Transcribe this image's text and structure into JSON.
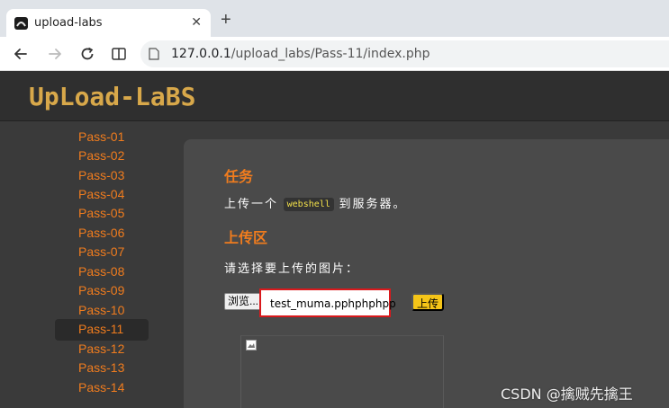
{
  "browser": {
    "tab_title": "upload-labs",
    "close_glyph": "✕",
    "new_tab_glyph": "+",
    "url_host": "127.0.0.1",
    "url_path": "/upload_labs/Pass-11/index.php"
  },
  "site": {
    "logo_text": "UpLoad-LaBS"
  },
  "sidebar": {
    "items": [
      {
        "label": "Pass-01"
      },
      {
        "label": "Pass-02"
      },
      {
        "label": "Pass-03"
      },
      {
        "label": "Pass-04"
      },
      {
        "label": "Pass-05"
      },
      {
        "label": "Pass-06"
      },
      {
        "label": "Pass-07"
      },
      {
        "label": "Pass-08"
      },
      {
        "label": "Pass-09"
      },
      {
        "label": "Pass-10"
      },
      {
        "label": "Pass-11"
      },
      {
        "label": "Pass-12"
      },
      {
        "label": "Pass-13"
      },
      {
        "label": "Pass-14"
      }
    ],
    "active": "Pass-11"
  },
  "main": {
    "task_heading": "任务",
    "task_prefix": "上传一个",
    "task_code": "webshell",
    "task_suffix": "到服务器。",
    "upload_heading": "上传区",
    "choose_label": "请选择要上传的图片：",
    "browse_label": "浏览...",
    "file_name": "test_muma.pphphphpp",
    "submit_label": "上传"
  },
  "watermark": "CSDN @擒贼先擒王",
  "colors": {
    "accent": "#f07c1e",
    "submit": "#f5c518",
    "highlight_box": "#d9191c"
  }
}
